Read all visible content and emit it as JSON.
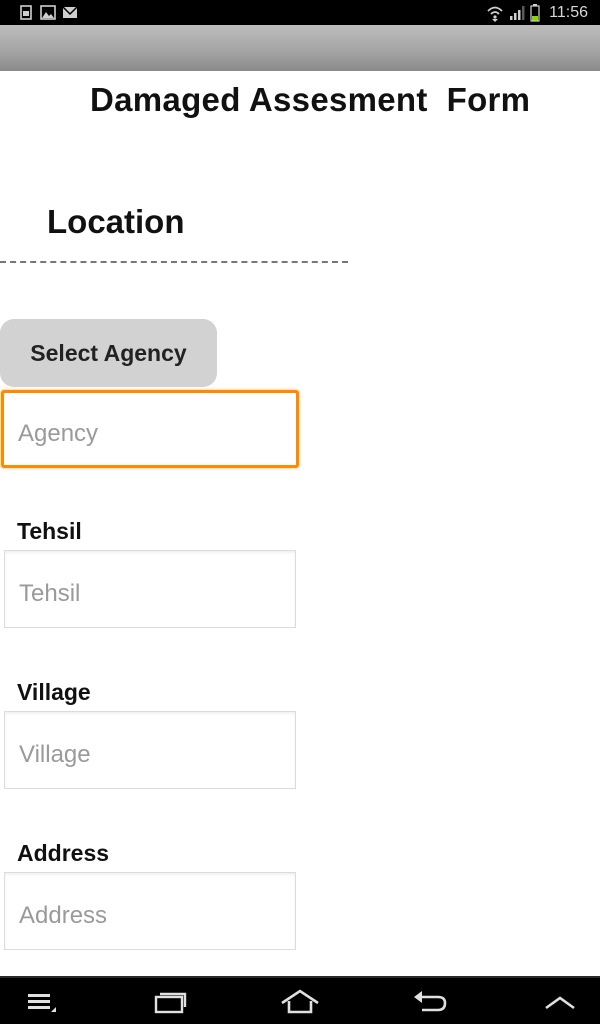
{
  "status_bar": {
    "time": "11:56",
    "notification_icons": [
      "sim-icon",
      "image-icon",
      "mail-icon"
    ],
    "system_icons": [
      "wifi-icon",
      "signal-icon",
      "battery-icon"
    ]
  },
  "form": {
    "title": "Damaged Assesment  Form",
    "section_title": "Location",
    "select_agency_label": "Select Agency",
    "agency_placeholder": "Agency",
    "tehsil_label": "Tehsil",
    "tehsil_placeholder": "Tehsil",
    "village_label": "Village",
    "village_placeholder": "Village",
    "address_label": "Address",
    "address_placeholder": "Address"
  },
  "nav_bar": {
    "buttons": [
      "menu-icon",
      "recent-apps-icon",
      "home-icon",
      "back-icon",
      "hide-keyboard-icon"
    ]
  },
  "colors": {
    "focus_border": "#ff8a00",
    "status_bar": "#000000",
    "button_bg": "#d2d2d2"
  }
}
